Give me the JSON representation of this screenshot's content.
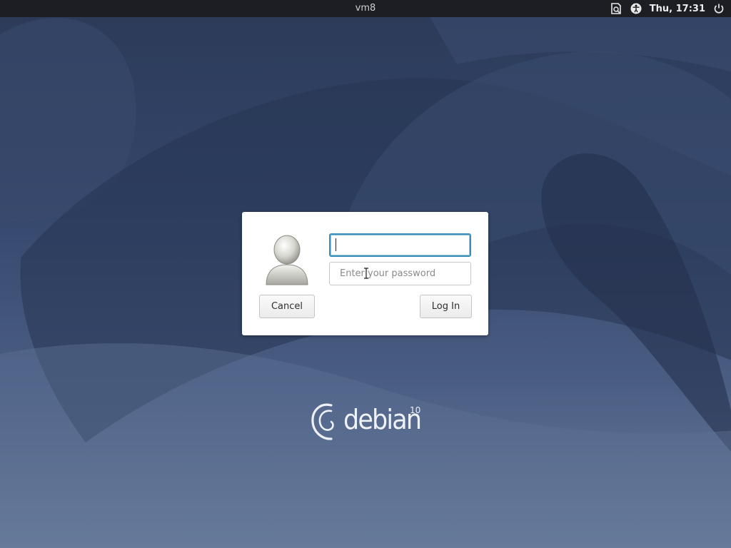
{
  "topbar": {
    "hostname": "vm8",
    "clock": "Thu, 17:31",
    "icons": [
      "network-icon",
      "accessibility-icon",
      "power-icon"
    ]
  },
  "login": {
    "username_value": "",
    "password_placeholder": "Enter your password",
    "cancel_label": "Cancel",
    "login_label": "Log In",
    "avatar_icon": "default-user-avatar-icon",
    "focus_color": "#3c8fb6"
  },
  "branding": {
    "wordmark": "debian",
    "version": "10",
    "logo_icon": "debian-swirl-icon"
  },
  "colors": {
    "topbar_bg": "#1c1e24",
    "wallpaper_top": "#2c3a57",
    "wallpaper_bottom": "#6e819f",
    "dialog_bg": "#ffffff"
  }
}
